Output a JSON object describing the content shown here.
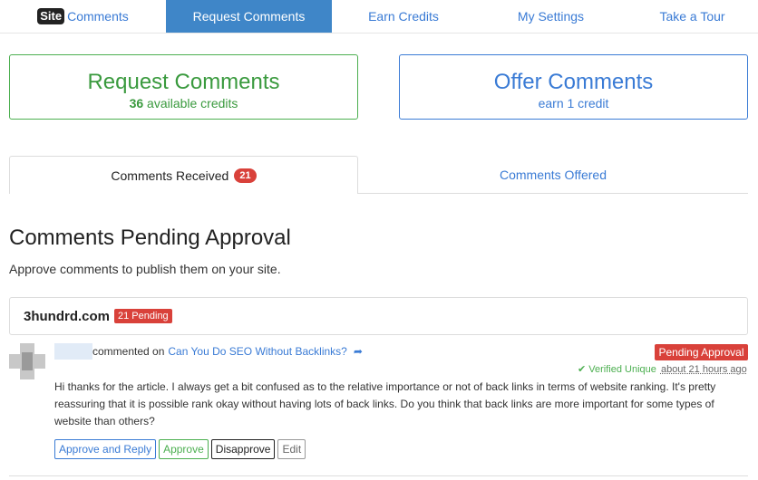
{
  "nav": {
    "logo_badge": "Site",
    "logo_text": "Comments",
    "items": [
      "Request Comments",
      "Earn Credits",
      "My Settings",
      "Take a Tour"
    ]
  },
  "cards": {
    "request": {
      "title": "Request Comments",
      "credits_count": "36",
      "credits_suffix": " available credits"
    },
    "offer": {
      "title": "Offer Comments",
      "subtitle": "earn 1 credit"
    }
  },
  "tabs": {
    "received_label": "Comments Received",
    "received_count": "21",
    "offered_label": "Comments Offered"
  },
  "section": {
    "title": "Comments Pending Approval",
    "description": "Approve comments to publish them on your site."
  },
  "site": {
    "name": "3hundrd.com",
    "pending": "21 Pending"
  },
  "comment": {
    "action_text": "commented on",
    "post_title": "Can You Do SEO Without Backlinks?",
    "status": "Pending Approval",
    "verified_text": "Verified Unique",
    "time_ago": "about 21 hours ago",
    "body": "Hi thanks for the article. I always get a bit confused as to the relative importance or not of back links in terms of website ranking. It's pretty reassuring that it is possible rank okay without having lots of back links. Do you think that back links are more important for some types of website than others?"
  },
  "actions": {
    "approve_reply": "Approve and Reply",
    "approve": "Approve",
    "disapprove": "Disapprove",
    "edit": "Edit"
  },
  "colors": {
    "green": "#4caf50",
    "blue": "#3a7bd5",
    "red": "#d9413a",
    "nav_active": "#3f86c8"
  },
  "icons": {
    "share": "share-arrow-icon",
    "check": "check-icon"
  }
}
